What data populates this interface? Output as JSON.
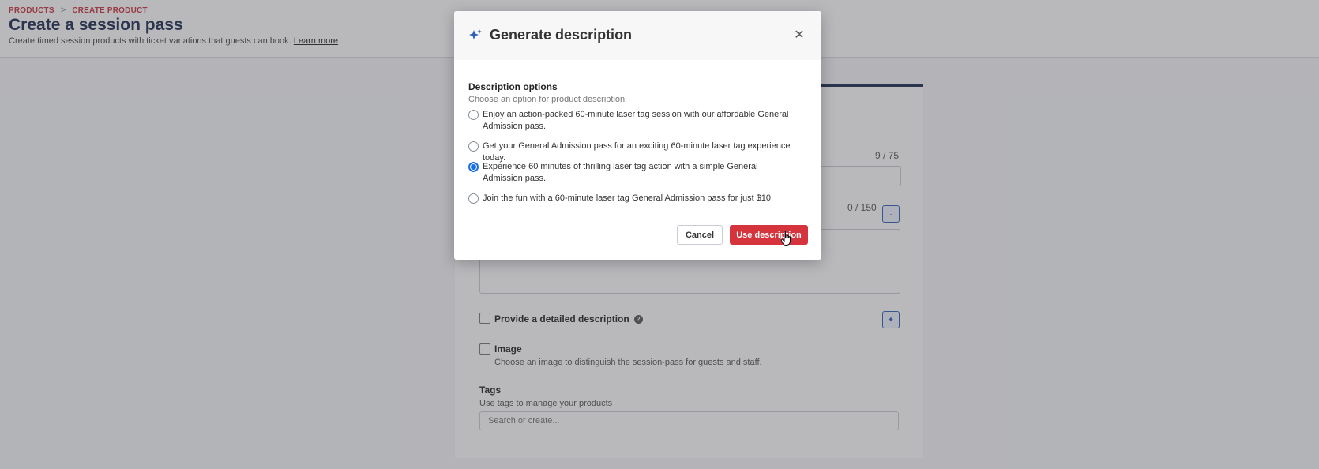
{
  "breadcrumb": {
    "item1": "PRODUCTS",
    "separator": ">",
    "item2": "CREATE PRODUCT"
  },
  "page": {
    "title": "Create a session pass",
    "subtitle": "Create timed session products with ticket variations that guests can book.",
    "learn_more": "Learn more"
  },
  "form": {
    "name_counter": "9 / 75",
    "desc_counter": "0 / 150",
    "detailed_label": "Provide a detailed description",
    "image_label": "Image",
    "image_help": "Choose an image to distinguish the session-pass for guests and staff.",
    "tags_label": "Tags",
    "tags_help": "Use tags to manage your products",
    "tags_placeholder": "Search or create..."
  },
  "modal": {
    "title": "Generate description",
    "options_title": "Description options",
    "options_subtitle": "Choose an option for product description.",
    "options": [
      {
        "text": "Enjoy an action-packed 60-minute laser tag session with our affordable General Admission pass.",
        "selected": false
      },
      {
        "text": "Get your General Admission pass for an exciting 60-minute laser tag experience today.",
        "selected": false
      },
      {
        "text": "Experience 60 minutes of thrilling laser tag action with a simple General Admission pass.",
        "selected": true
      },
      {
        "text": "Join the fun with a 60-minute laser tag General Admission pass for just $10.",
        "selected": false
      }
    ],
    "cancel_label": "Cancel",
    "use_label": "Use description"
  },
  "colors": {
    "accent_red": "#d6343c",
    "navy": "#1b2a4e",
    "radio_blue": "#1a6fe0"
  },
  "icons": [
    "sparkle-icon",
    "close-icon",
    "help-icon",
    "chevron-right-icon",
    "hand-cursor-icon"
  ]
}
